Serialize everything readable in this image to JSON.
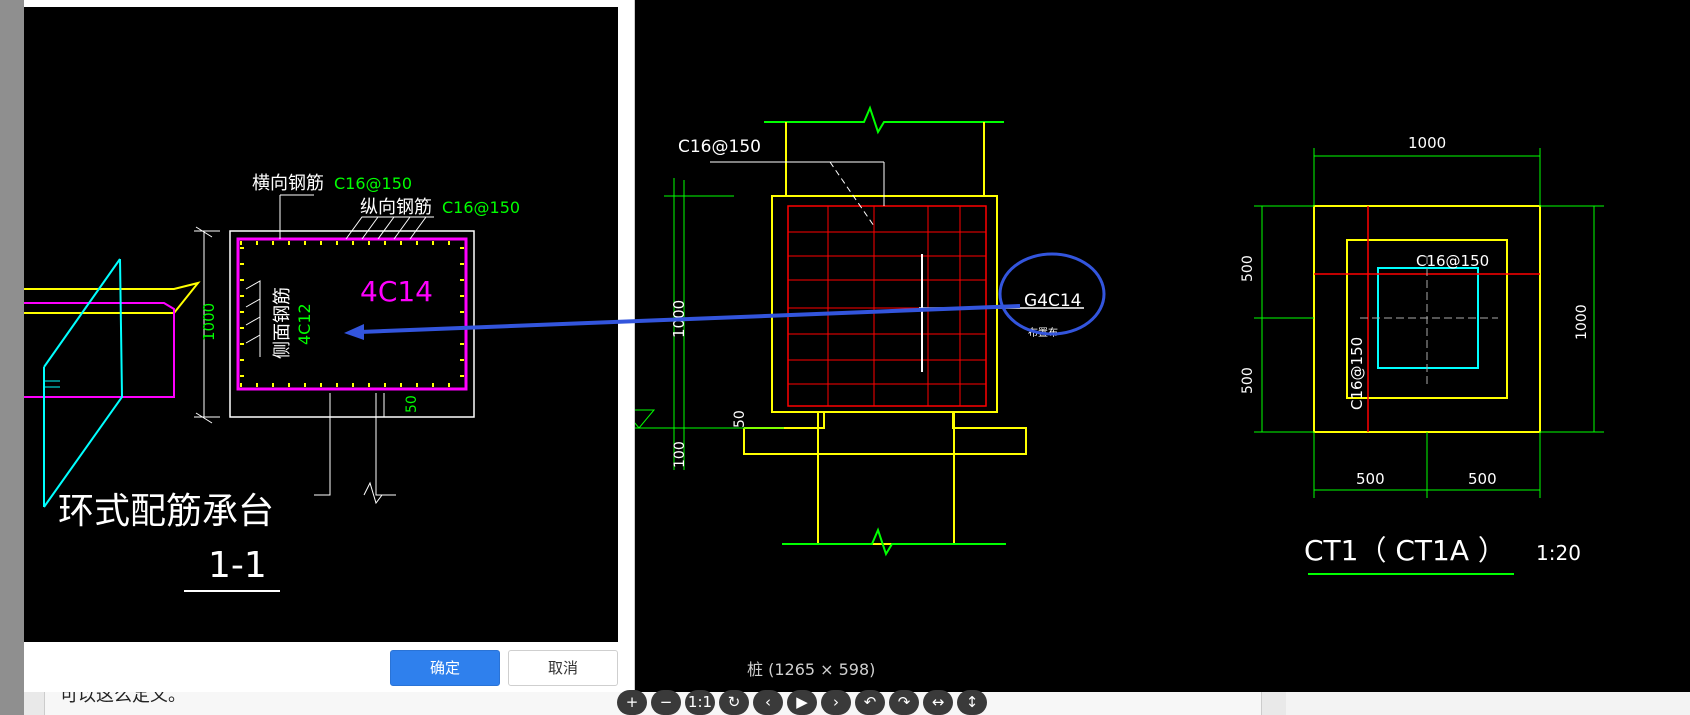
{
  "dialog": {
    "drawing": {
      "lbl_horizontal_rebar": "横向钢筋",
      "val_horizontal_rebar": "C16@150",
      "lbl_longitudinal_rebar": "纵向钢筋",
      "val_longitudinal_rebar": "C16@150",
      "main_rebar": "4C14",
      "lbl_side_rebar": "侧面钢筋",
      "val_side_rebar": "4C12",
      "dim_height": "1000",
      "dim_50": "50",
      "title": "环式配筋承台",
      "section": "1-1"
    },
    "ok_label": "确定",
    "cancel_label": "取消"
  },
  "background_text": "可以这么定义。",
  "cad": {
    "rebar_top": "C16@150",
    "dim_1000_left": "1000",
    "dim_50": "50",
    "dim_100": "100",
    "circled_label": "G4C14",
    "circled_sub": "布置布",
    "plan_dim_top": "1000",
    "plan_dim_500_a": "500",
    "plan_dim_500_b": "500",
    "plan_dim_right": "1000",
    "plan_dim_bottom_a": "500",
    "plan_dim_bottom_b": "500",
    "plan_rebar_h": "C16@150",
    "plan_rebar_v": "C16@150",
    "plan_title": "CT1（ CT1A ）",
    "plan_scale": "1:20"
  },
  "viewer": {
    "caption": "桩 (1265 × 598)",
    "toolbar": [
      "+",
      "−",
      "1:1",
      "↻",
      "‹",
      "▶",
      "›",
      "↶",
      "↷",
      "↔",
      "↕"
    ]
  },
  "colors": {
    "ok_button": "#2f80ed",
    "cad_yellow": "#ffff00",
    "cad_green": "#00ff00",
    "cad_red": "#ff0000",
    "cad_magenta": "#ff00ff",
    "cad_cyan": "#00ffff",
    "annotation_blue": "#3355dd"
  }
}
